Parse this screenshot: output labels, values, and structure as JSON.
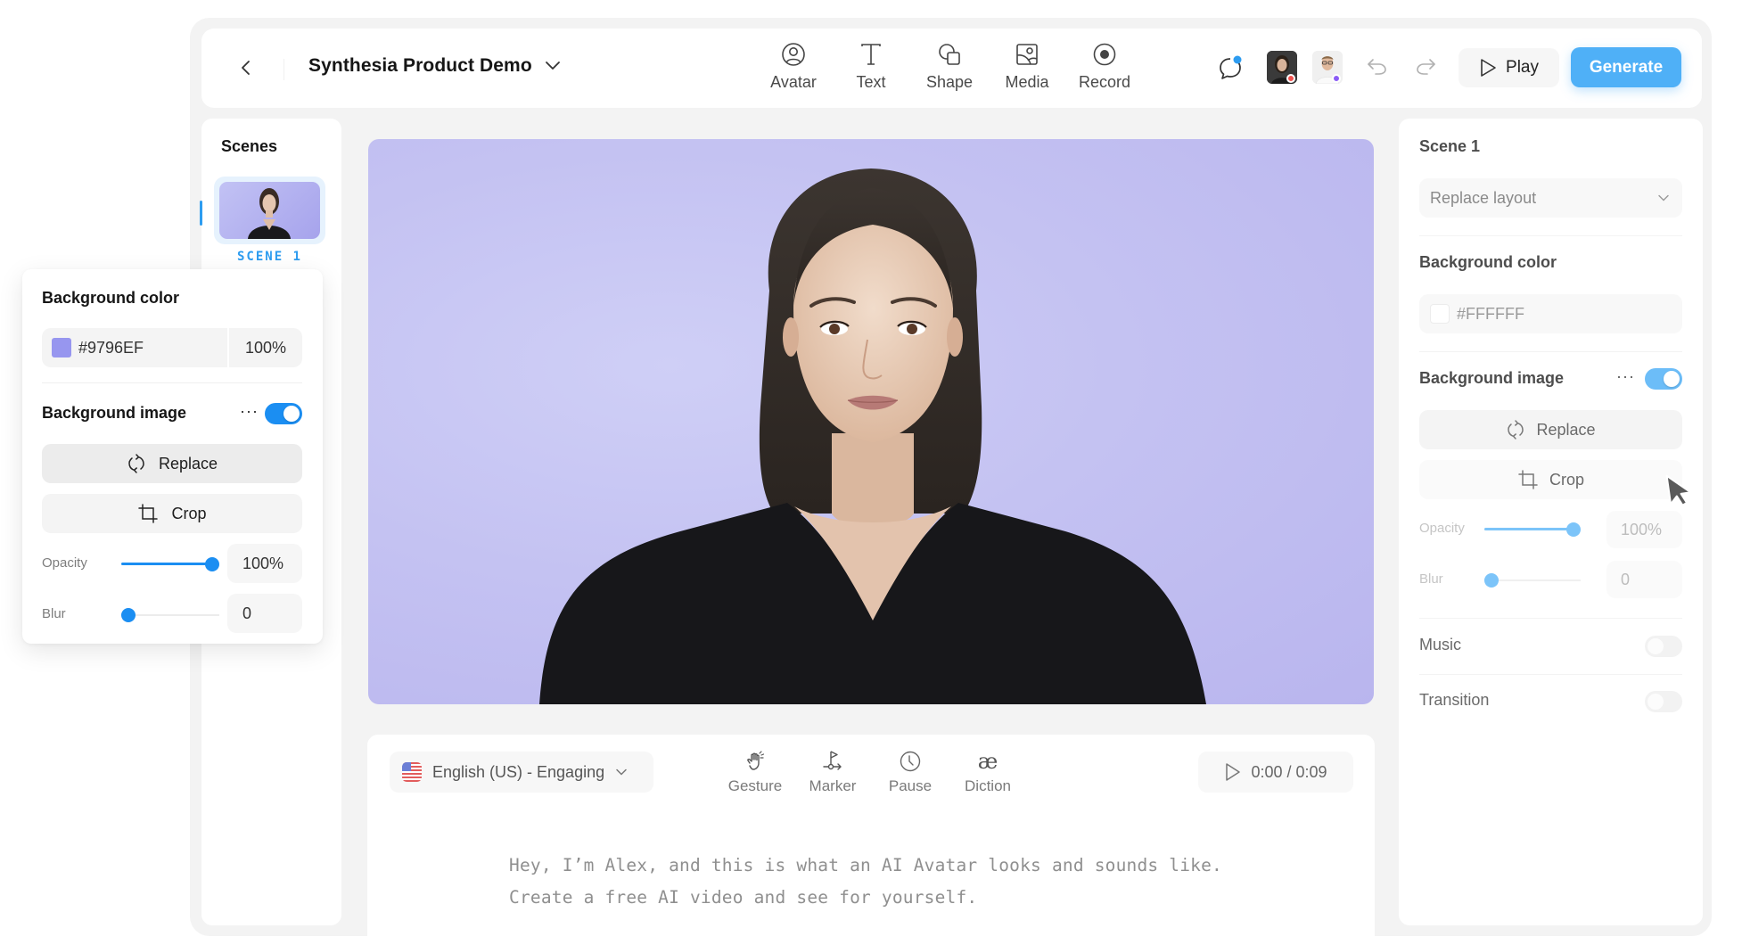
{
  "header": {
    "project_title": "Synthesia Product Demo",
    "tools": [
      {
        "label": "Avatar",
        "icon": "avatar-icon"
      },
      {
        "label": "Text",
        "icon": "text-icon"
      },
      {
        "label": "Shape",
        "icon": "shape-icon"
      },
      {
        "label": "Media",
        "icon": "media-icon"
      },
      {
        "label": "Record",
        "icon": "record-icon"
      }
    ],
    "collaborators": [
      {
        "name": "collaborator-1",
        "status_color": "#f0524f"
      },
      {
        "name": "collaborator-2",
        "status_color": "#8b5cf6"
      }
    ],
    "play_label": "Play",
    "generate_label": "Generate",
    "accent_color": "#4fb0f7"
  },
  "scenes": {
    "title": "Scenes",
    "items": [
      {
        "label": "SCENE 1",
        "selected": true
      }
    ]
  },
  "canvas": {
    "background_color": "#9796EF",
    "subject": "AI avatar (female, dark hair, black top)"
  },
  "script": {
    "voice": "English (US) - Engaging",
    "voice_flag": "us-flag",
    "tools": [
      {
        "label": "Gesture",
        "icon": "gesture-icon"
      },
      {
        "label": "Marker",
        "icon": "marker-icon"
      },
      {
        "label": "Pause",
        "icon": "clock-icon"
      },
      {
        "label": "Diction",
        "icon": "diction-icon"
      }
    ],
    "timecode": "0:00 / 0:09",
    "lines": [
      "Hey, I’m Alex, and this is what an AI Avatar looks and sounds like.",
      "Create a free AI video and see for yourself."
    ]
  },
  "popup": {
    "bg_color_label": "Background color",
    "bg_color_value": "#9796EF",
    "bg_color_opacity": "100%",
    "bg_image_label": "Background image",
    "bg_image_enabled": true,
    "replace_label": "Replace",
    "crop_label": "Crop",
    "opacity_label": "Opacity",
    "opacity_value": "100%",
    "opacity_fraction": 1.0,
    "blur_label": "Blur",
    "blur_value": "0",
    "blur_fraction": 0.0
  },
  "right_panel": {
    "scene_title": "Scene 1",
    "layout_select": "Replace layout",
    "bg_color_label": "Background color",
    "bg_color_value": "#FFFFFF",
    "bg_image_label": "Background image",
    "bg_image_enabled": true,
    "replace_label": "Replace",
    "crop_label": "Crop",
    "opacity_label": "Opacity",
    "opacity_value": "100%",
    "opacity_fraction": 1.0,
    "blur_label": "Blur",
    "blur_value": "0",
    "blur_fraction": 0.0,
    "music_label": "Music",
    "music_enabled": false,
    "transition_label": "Transition",
    "transition_enabled": false
  }
}
